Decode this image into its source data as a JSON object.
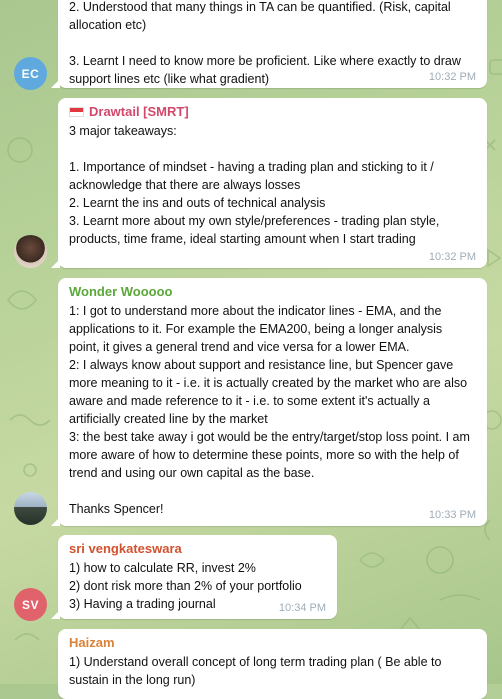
{
  "messages": [
    {
      "sender": "",
      "initials": "EC",
      "avatar_color": "#5fa9de",
      "text": "2. Understood that many things in TA can be quantified. (Risk, capital allocation etc)\n\n3. Learnt I need to know more be proficient. Like where exactly to draw support lines etc (like what gradient)",
      "time": "10:32 PM"
    },
    {
      "sender": "Drawtail [SMRT]",
      "sender_color": "#d2486b",
      "flag_icon": "singapore-flag-icon",
      "text": "3 major takeaways:\n\n1. Importance of mindset - having a trading plan and sticking to it / acknowledge that there are always losses\n2. Learnt the ins and outs of technical analysis\n3. Learnt more about my own style/preferences - trading plan style, products, time frame, ideal starting amount when I start trading",
      "time": "10:32 PM"
    },
    {
      "sender": "Wonder Wooooo",
      "sender_color": "#5aa83a",
      "text": "1: I got to understand more about the indicator lines - EMA, and the applications to it. For example the EMA200, being a longer analysis point, it gives a general trend and vice versa for a lower EMA.\n2: I always know about support and resistance line, but Spencer gave more meaning to it - i.e. it is actually created by the market who are also aware and made reference to it - i.e. to some extent it's actually a artificially created line by the market\n3: the best take away i got would be the entry/target/stop loss point. I am more aware of how to determine these points, more so with the help of trend and using our own capital as the base.\n\nThanks Spencer!",
      "time": "10:33 PM"
    },
    {
      "sender": "sri vengkateswara",
      "sender_color": "#d2522e",
      "initials": "SV",
      "avatar_color": "#e0626b",
      "text": "1) how to calculate RR, invest 2%\n2) dont risk more than 2% of your portfolio\n3) Having a trading journal",
      "time": "10:34 PM"
    },
    {
      "sender": "Haizam",
      "sender_color": "#d8823a",
      "text": "1) Understand overall concept of long term trading plan ( Be able to sustain in the long run)",
      "time": ""
    }
  ]
}
